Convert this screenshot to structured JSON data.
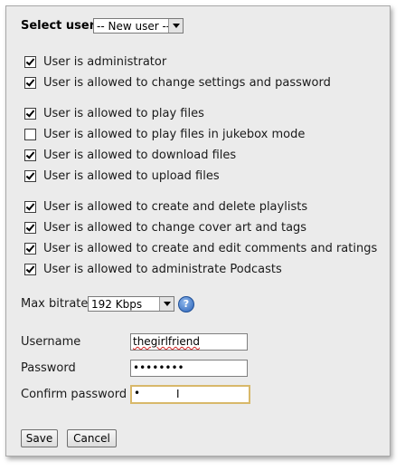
{
  "select_user": {
    "label": "Select user",
    "selected": "-- New user --"
  },
  "permissions": [
    {
      "label": "User is administrator",
      "checked": true
    },
    {
      "label": "User is allowed to change settings and password",
      "checked": true
    },
    {
      "label": "User is allowed to play files",
      "checked": true
    },
    {
      "label": "User is allowed to play files in jukebox mode",
      "checked": false
    },
    {
      "label": "User is allowed to download files",
      "checked": true
    },
    {
      "label": "User is allowed to upload files",
      "checked": true
    },
    {
      "label": "User is allowed to create and delete playlists",
      "checked": true
    },
    {
      "label": "User is allowed to change cover art and tags",
      "checked": true
    },
    {
      "label": "User is allowed to create and edit comments and ratings",
      "checked": true
    },
    {
      "label": "User is allowed to administrate Podcasts",
      "checked": true
    }
  ],
  "bitrate": {
    "label": "Max bitrate",
    "selected": "192 Kbps",
    "help_icon": "?"
  },
  "form": {
    "username_label": "Username",
    "username_value": "thegirlfriend",
    "password_label": "Password",
    "password_value": "••••••••",
    "confirm_label": "Confirm password",
    "confirm_value": "•",
    "cursor_icon": "I"
  },
  "buttons": {
    "save": "Save",
    "cancel": "Cancel"
  }
}
